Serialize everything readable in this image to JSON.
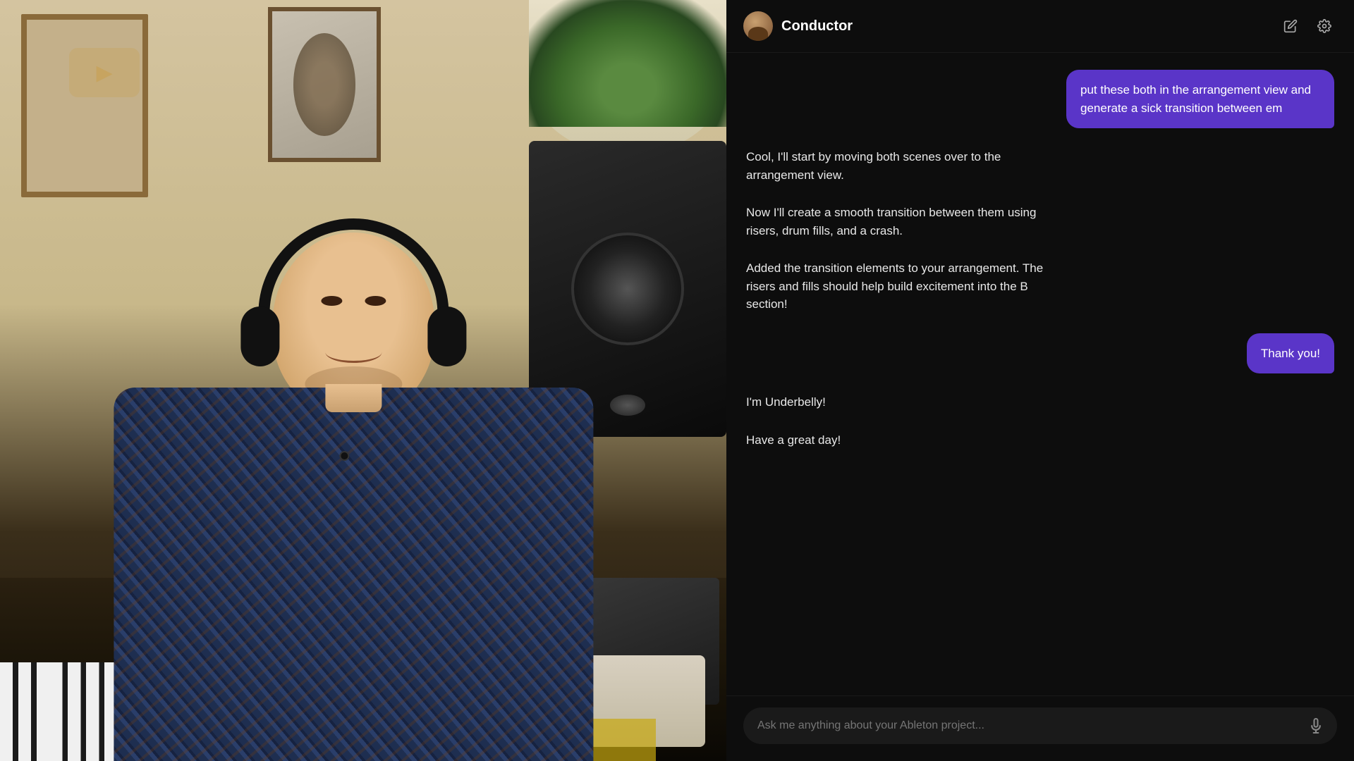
{
  "header": {
    "title": "Conductor",
    "compose_icon": "✏",
    "settings_icon": "⚙"
  },
  "messages": [
    {
      "id": "msg-1",
      "role": "user",
      "text": "put these both in the arrangement view and generate a sick transition between em"
    },
    {
      "id": "msg-2",
      "role": "assistant",
      "text": "Cool, I'll start by moving both scenes over to the arrangement view."
    },
    {
      "id": "msg-3",
      "role": "assistant",
      "text": "Now I'll create a smooth transition between them using risers, drum fills, and a crash."
    },
    {
      "id": "msg-4",
      "role": "assistant",
      "text": "Added the transition elements to your arrangement. The risers and fills should help build excitement into the B section!"
    },
    {
      "id": "msg-5",
      "role": "user",
      "text": "Thank you!"
    },
    {
      "id": "msg-6",
      "role": "assistant",
      "text": "I'm Underbelly!"
    },
    {
      "id": "msg-7",
      "role": "assistant",
      "text": "Have a great day!"
    }
  ],
  "input": {
    "placeholder": "Ask me anything about your Ableton project..."
  },
  "colors": {
    "user_bubble": "#5a35c8",
    "background": "#0d0d0d",
    "text_primary": "#ffffff",
    "text_secondary": "#e8e8e8",
    "input_bg": "#1a1a1a"
  }
}
